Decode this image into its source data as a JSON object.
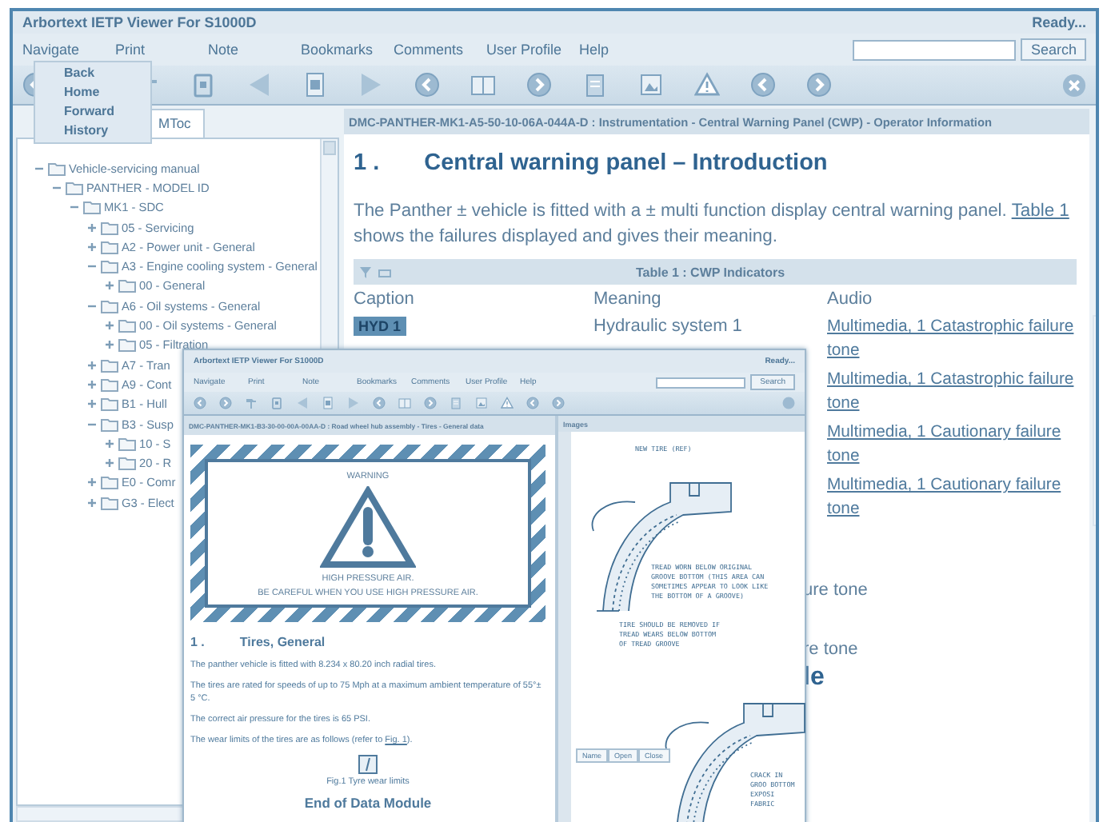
{
  "window": {
    "title": "Arbortext IETP Viewer For S1000D",
    "status": "Ready..."
  },
  "menu": [
    "Navigate",
    "Print",
    "Note",
    "Bookmarks",
    "Comments",
    "User Profile",
    "Help"
  ],
  "search": {
    "button": "Search"
  },
  "navigate_menu": [
    "Back",
    "Home",
    "Forward",
    "History"
  ],
  "left_panel": {
    "tab": "MToc",
    "tree": [
      {
        "label": "Vehicle-servicing manual",
        "expanded": true,
        "children": [
          {
            "label": "PANTHER - MODEL ID",
            "expanded": true,
            "children": [
              {
                "label": "MK1 - SDC",
                "expanded": true,
                "children": [
                  {
                    "label": "05 - Servicing",
                    "expanded": false
                  },
                  {
                    "label": "A2 - Power unit - General",
                    "expanded": false
                  },
                  {
                    "label": "A3 - Engine cooling system - General",
                    "expanded": true,
                    "children": [
                      {
                        "label": "00 - General",
                        "expanded": false
                      }
                    ]
                  },
                  {
                    "label": "A6 - Oil systems - General",
                    "expanded": true,
                    "children": [
                      {
                        "label": "00 - Oil systems - General",
                        "expanded": false
                      },
                      {
                        "label": "05 - Filtration",
                        "expanded": false
                      }
                    ]
                  },
                  {
                    "label": "A7 - Tran",
                    "expanded": false
                  },
                  {
                    "label": "A9 - Cont",
                    "expanded": false
                  },
                  {
                    "label": "B1 - Hull",
                    "expanded": false
                  },
                  {
                    "label": "B3 - Susp",
                    "expanded": true,
                    "children": [
                      {
                        "label": "10 - S",
                        "expanded": false
                      },
                      {
                        "label": "20 - R",
                        "expanded": false
                      }
                    ]
                  },
                  {
                    "label": "E0 - Comr",
                    "expanded": false
                  },
                  {
                    "label": "G3 - Elect",
                    "expanded": false
                  }
                ]
              }
            ]
          }
        ]
      }
    ]
  },
  "content": {
    "header": "DMC-PANTHER-MK1-A5-50-10-06A-044A-D : Instrumentation - Central Warning Panel (CWP) - Operator Information",
    "number": "1 .",
    "heading": "Central warning panel – Introduction",
    "para_before": "The Panther ± vehicle is fitted with a ± multi function display central warning panel. ",
    "para_link": "Table 1",
    "para_after": " shows the failures displayed and gives their meaning.",
    "table": {
      "title": "Table  1 : CWP Indicators",
      "columns": [
        "Caption",
        "Meaning",
        "Audio"
      ],
      "rows": [
        {
          "caption": "HYD 1",
          "meaning": "Hydraulic    system 1",
          "audio": "Multimedia, 1 Catastrophic failure tone"
        },
        {
          "caption": "",
          "meaning": "",
          "audio": "Multimedia, 1 Catastrophic failure tone"
        },
        {
          "caption": "",
          "meaning": "",
          "audio": "Multimedia, 1 Cautionary failure tone"
        },
        {
          "caption": "",
          "meaning": "",
          "audio": "Multimedia, 1 Cautionary failure tone"
        }
      ]
    },
    "fragments": [
      {
        "text": "ure tone",
        "kind": "text"
      },
      {
        "text": "re tone",
        "kind": "text"
      },
      {
        "text": "le",
        "kind": "heading"
      }
    ]
  },
  "inner_window": {
    "title": "Arbortext IETP Viewer For S1000D",
    "status": "Ready...",
    "menu": [
      "Navigate",
      "Print",
      "Note",
      "Bookmarks",
      "Comments",
      "User Profile",
      "Help"
    ],
    "search_button": "Search",
    "header": "DMC-PANTHER-MK1-B3-30-00-00A-00AA-D : Road wheel hub assembly - Tires - General data",
    "images_header": "Images",
    "warning": {
      "title": "WARNING",
      "line1": "HIGH PRESSURE AIR.",
      "line2": "BE CAREFUL   WHEN YOU USE HIGH PRESSURE AIR."
    },
    "number": "1 .",
    "heading": "Tires, General",
    "paragraphs": [
      "The panther vehicle is fitted with 8.234 x 80.20 inch radial tires.",
      "The tires are rated for speeds of up to 75 Mph at a maximum ambient temperature of 55°± 5 °C.",
      "The correct air pressure for the tires is 65 PSI."
    ],
    "wear_before": "The wear limits of the tires are as follows (refer to ",
    "wear_link": "Fig. 1",
    "wear_after": ").",
    "fig_caption": "Fig.1   Tyre wear limits",
    "end": "End of Data Module",
    "image_labels": [
      "NEW TIRE (REF)",
      "TREAD WORN BELOW ORIGINAL GROOVE BOTTOM (THIS AREA CAN SOMETIMES APPEAR TO LOOK LIKE THE BOTTOM OF A GROOVE)",
      "TIRE SHOULD BE REMOVED IF TREAD WEARS BELOW BOTTOM OF TREAD GROOVE",
      "CRACK IN GROO BOTTOM EXPOSI FABRIC"
    ],
    "image_buttons": [
      "Name",
      "Open",
      "Close"
    ]
  }
}
